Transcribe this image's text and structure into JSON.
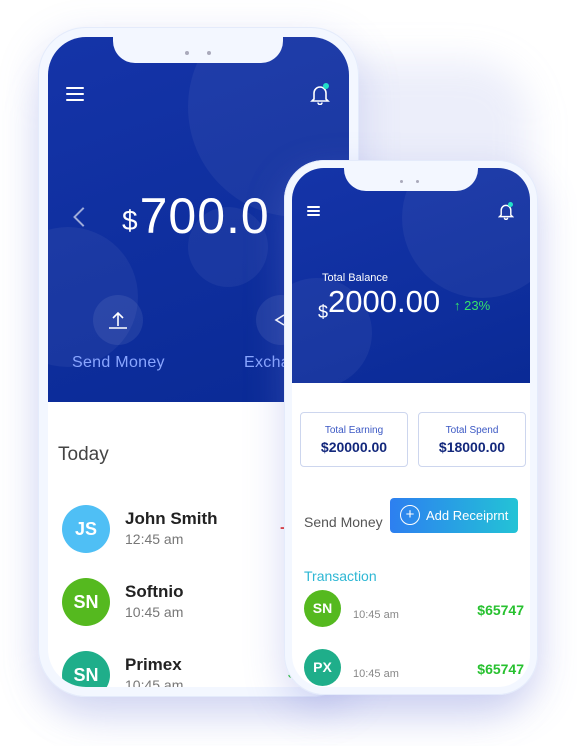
{
  "phone_back": {
    "balance_currency": "$",
    "balance_value": "700.0",
    "actions": [
      {
        "label": "Send Money",
        "icon": "upload-icon"
      },
      {
        "label": "Excha",
        "icon": "exchange-icon"
      }
    ],
    "section_title": "Today",
    "transactions": [
      {
        "initials": "JS",
        "name": "John Smith",
        "time": "12:45 am",
        "amount": "-$",
        "avatar_color": "#4fbff5",
        "amount_color": "#e53935"
      },
      {
        "initials": "SN",
        "name": "Softnio",
        "time": "10:45 am",
        "amount": "$",
        "avatar_color": "#55b91f",
        "amount_color": "#27c12f"
      },
      {
        "initials": "SN",
        "name": "Primex",
        "time": "10:45 am",
        "amount": "$",
        "avatar_color": "#1fae8a",
        "amount_color": "#27c12f"
      }
    ]
  },
  "phone_front": {
    "balance_label": "Total Balance",
    "balance_currency": "$",
    "balance_value": "2000.00",
    "balance_change": "↑ 23%",
    "earning_label": "Total Earning",
    "earning_value": "$20000.00",
    "spend_label": "Total Spend",
    "spend_value": "$18000.00",
    "send_money_label": "Send Money",
    "add_recipient_label": "Add Receiprnt",
    "transactions_title": "Transaction",
    "transactions": [
      {
        "initials": "SN",
        "time": "10:45 am",
        "amount": "$65747",
        "avatar_color": "#55b91f"
      },
      {
        "initials": "PX",
        "time": "10:45 am",
        "amount": "$65747",
        "avatar_color": "#1fae8a"
      }
    ]
  },
  "colors": {
    "primary": "#0f2f9f",
    "accent": "#22e0c8",
    "positive": "#27c12f",
    "negative": "#e53935"
  }
}
